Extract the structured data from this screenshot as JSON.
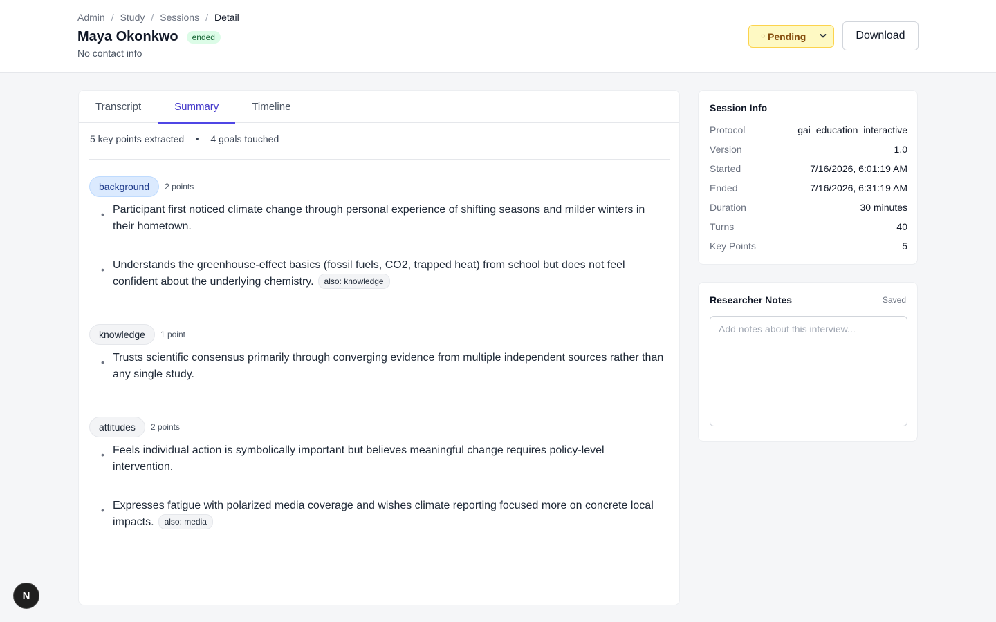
{
  "breadcrumb": [
    "Admin",
    "Study",
    "Sessions",
    "Detail"
  ],
  "participant": {
    "name": "Maya Okonkwo",
    "status": "ended",
    "contact": "No contact info"
  },
  "actions": {
    "review_status": "Pending",
    "review_icon": "○",
    "download_label": "Download"
  },
  "tabs": [
    "Transcript",
    "Summary",
    "Timeline"
  ],
  "active_tab": "Summary",
  "summary": {
    "key_points": "5 key points extracted",
    "goals": "4 goals touched",
    "separator": "•"
  },
  "groups": [
    {
      "tag": "background",
      "count": "2 points",
      "points": [
        {
          "text": "Participant first noticed climate change through personal experience of shifting seasons and milder winters in their hometown.",
          "also": ""
        },
        {
          "text": "Understands the greenhouse-effect basics (fossil fuels, CO2, trapped heat) from school but does not feel confident about the underlying chemistry.",
          "also": "also: knowledge"
        }
      ]
    },
    {
      "tag": "knowledge",
      "count": "1 point",
      "points": [
        {
          "text": "Trusts scientific consensus primarily through converging evidence from multiple independent sources rather than any single study.",
          "also": ""
        }
      ]
    },
    {
      "tag": "attitudes",
      "count": "2 points",
      "points": [
        {
          "text": "Feels individual action is symbolically important but believes meaningful change requires policy-level intervention.",
          "also": ""
        },
        {
          "text": "Expresses fatigue with polarized media coverage and wishes climate reporting focused more on concrete local impacts.",
          "also": "also: media"
        }
      ]
    }
  ],
  "session_info": {
    "title": "Session Info",
    "rows": [
      {
        "label": "Protocol",
        "value": "gai_education_interactive"
      },
      {
        "label": "Version",
        "value": "1.0"
      },
      {
        "label": "Started",
        "value": "7/16/2026, 6:01:19 AM"
      },
      {
        "label": "Ended",
        "value": "7/16/2026, 6:31:19 AM"
      },
      {
        "label": "Duration",
        "value": "30 minutes"
      },
      {
        "label": "Turns",
        "value": "40"
      },
      {
        "label": "Key Points",
        "value": "5"
      }
    ]
  },
  "notes": {
    "title": "Researcher Notes",
    "saved": "Saved",
    "placeholder": "Add notes about this interview...",
    "value": ""
  },
  "dev_badge": "N",
  "colors": {
    "accent": "#4f46e5",
    "status_ended_bg": "#dcfce7",
    "pending_bg": "#fef9c3",
    "primary_tag_bg": "#dbeafe"
  }
}
